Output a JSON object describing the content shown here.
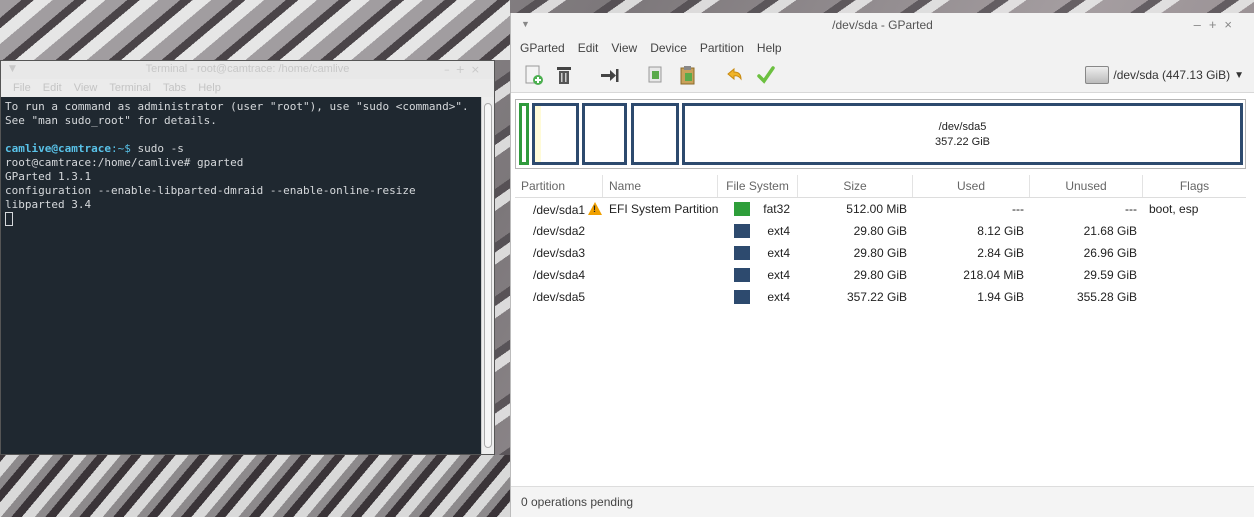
{
  "terminal": {
    "title": "Terminal - root@camtrace: /home/camlive",
    "menu": [
      "File",
      "Edit",
      "View",
      "Terminal",
      "Tabs",
      "Help"
    ],
    "lines": [
      "To run a command as administrator (user \"root\"), use \"sudo <command>\".",
      "See \"man sudo_root\" for details."
    ],
    "prompt1_user": "camlive@camtrace",
    "prompt1_path": ":~$",
    "prompt1_cmd": " sudo -s",
    "prompt2": "root@camtrace:/home/camlive# gparted",
    "output": [
      "GParted 1.3.1",
      "configuration --enable-libparted-dmraid --enable-online-resize",
      "libparted 3.4"
    ]
  },
  "gparted": {
    "title": "/dev/sda - GParted",
    "menu": [
      "GParted",
      "Edit",
      "View",
      "Device",
      "Partition",
      "Help"
    ],
    "toolbar": {
      "new": "new-partition-icon",
      "delete": "delete-icon",
      "resize": "resize-move-icon",
      "copy": "copy-icon",
      "paste": "paste-icon",
      "undo": "undo-icon",
      "apply": "apply-icon"
    },
    "device": "/dev/sda (447.13 GiB)",
    "map_label_name": "/dev/sda5",
    "map_label_size": "357.22 GiB",
    "columns": [
      "Partition",
      "Name",
      "File System",
      "Size",
      "Used",
      "Unused",
      "Flags"
    ],
    "rows": [
      {
        "partition": "/dev/sda1",
        "warning": true,
        "name": "EFI System Partition",
        "fs": "fat32",
        "fs_color": "#2e9e3a",
        "size": "512.00 MiB",
        "used": "---",
        "unused": "---",
        "flags": "boot, esp"
      },
      {
        "partition": "/dev/sda2",
        "warning": false,
        "name": "",
        "fs": "ext4",
        "fs_color": "#2d4a6e",
        "size": "29.80 GiB",
        "used": "8.12 GiB",
        "unused": "21.68 GiB",
        "flags": ""
      },
      {
        "partition": "/dev/sda3",
        "warning": false,
        "name": "",
        "fs": "ext4",
        "fs_color": "#2d4a6e",
        "size": "29.80 GiB",
        "used": "2.84 GiB",
        "unused": "26.96 GiB",
        "flags": ""
      },
      {
        "partition": "/dev/sda4",
        "warning": false,
        "name": "",
        "fs": "ext4",
        "fs_color": "#2d4a6e",
        "size": "29.80 GiB",
        "used": "218.04 MiB",
        "unused": "29.59 GiB",
        "flags": ""
      },
      {
        "partition": "/dev/sda5",
        "warning": false,
        "name": "",
        "fs": "ext4",
        "fs_color": "#2d4a6e",
        "size": "357.22 GiB",
        "used": "1.94 GiB",
        "unused": "355.28 GiB",
        "flags": ""
      }
    ],
    "status": "0 operations pending"
  }
}
